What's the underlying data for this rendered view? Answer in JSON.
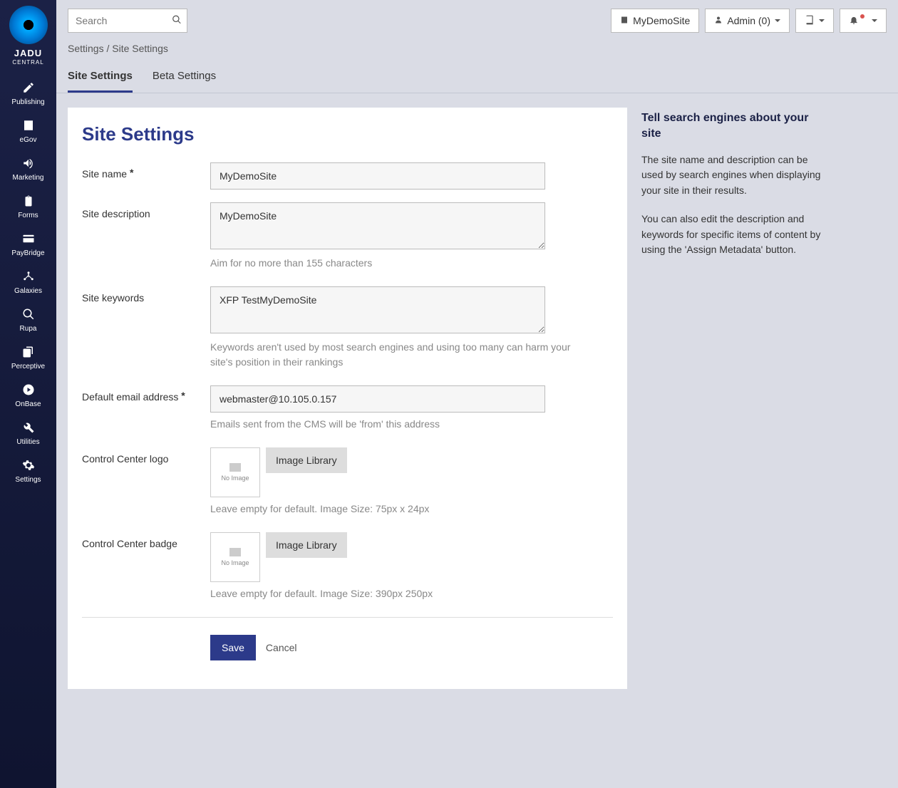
{
  "brand": {
    "name": "JADU",
    "sub": "CENTRAL"
  },
  "sidebar": {
    "items": [
      {
        "label": "Publishing",
        "icon": "pencil"
      },
      {
        "label": "eGov",
        "icon": "building"
      },
      {
        "label": "Marketing",
        "icon": "bullhorn"
      },
      {
        "label": "Forms",
        "icon": "clipboard"
      },
      {
        "label": "PayBridge",
        "icon": "card"
      },
      {
        "label": "Galaxies",
        "icon": "nodes"
      },
      {
        "label": "Rupa",
        "icon": "search"
      },
      {
        "label": "Perceptive",
        "icon": "copy"
      },
      {
        "label": "OnBase",
        "icon": "play"
      },
      {
        "label": "Utilities",
        "icon": "wrench"
      },
      {
        "label": "Settings",
        "icon": "gear"
      }
    ]
  },
  "topbar": {
    "search_placeholder": "Search",
    "site_label": "MyDemoSite",
    "user_label": "Admin (0)"
  },
  "breadcrumb": {
    "root": "Settings",
    "sep": "/",
    "current": "Site Settings"
  },
  "tabs": [
    {
      "label": "Site Settings",
      "active": true
    },
    {
      "label": "Beta Settings",
      "active": false
    }
  ],
  "page": {
    "title": "Site Settings",
    "fields": {
      "site_name": {
        "label": "Site name",
        "required": true,
        "value": "MyDemoSite"
      },
      "site_desc": {
        "label": "Site description",
        "value": "MyDemoSite",
        "help": "Aim for no more than 155 characters"
      },
      "site_keys": {
        "label": "Site keywords",
        "value": "XFP TestMyDemoSite",
        "help": "Keywords aren't used by most search engines and using too many can harm your site's position in their rankings"
      },
      "email": {
        "label": "Default email address",
        "required": true,
        "value": "webmaster@10.105.0.157",
        "help": "Emails sent from the CMS will be 'from' this address"
      },
      "cc_logo": {
        "label": "Control Center logo",
        "thumb_text": "No Image",
        "button": "Image Library",
        "help": "Leave empty for default. Image Size: 75px x 24px"
      },
      "cc_badge": {
        "label": "Control Center badge",
        "thumb_text": "No Image",
        "button": "Image Library",
        "help": "Leave empty for default. Image Size: 390px 250px"
      }
    },
    "actions": {
      "save": "Save",
      "cancel": "Cancel"
    }
  },
  "aside": {
    "heading": "Tell search engines about your site",
    "p1": "The site name and description can be used by search engines when displaying your site in their results.",
    "p2": "You can also edit the description and keywords for specific items of content by using the 'Assign Metadata' button."
  }
}
